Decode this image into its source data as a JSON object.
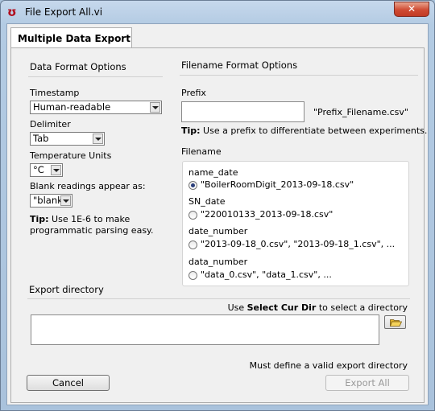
{
  "window": {
    "title": "File Export All.vi",
    "close_glyph": "✕",
    "app_icon": "labview-icon"
  },
  "tab": {
    "label": "Multiple Data Export"
  },
  "data_format": {
    "heading": "Data Format Options",
    "timestamp_label": "Timestamp",
    "timestamp_value": "Human-readable",
    "delimiter_label": "Delimiter",
    "delimiter_value": "Tab",
    "temp_units_label": "Temperature Units",
    "temp_units_value": "°C",
    "blank_label": "Blank readings appear as:",
    "blank_value": "\"blank\"",
    "tip_bold": "Tip:",
    "tip_line1": " Use 1E-6 to make",
    "tip_line2": "programmatic parsing easy."
  },
  "filename_format": {
    "heading": "Filename Format Options",
    "prefix_label": "Prefix",
    "prefix_value": "",
    "prefix_example": "\"Prefix_Filename.csv\"",
    "tip_bold": "Tip:",
    "tip_text": " Use a prefix to differentiate between experiments.",
    "filename_label": "Filename",
    "options": [
      {
        "name": "name_date",
        "example": "\"BoilerRoomDigit_2013-09-18.csv\"",
        "selected": true
      },
      {
        "name": "SN_date",
        "example": "\"220010133_2013-09-18.csv\"",
        "selected": false
      },
      {
        "name": "date_number",
        "example": "\"2013-09-18_0.csv\", \"2013-09-18_1.csv\", ...",
        "selected": false
      },
      {
        "name": "data_number",
        "example": "\"data_0.csv\", \"data_1.csv\", ...",
        "selected": false
      }
    ]
  },
  "export": {
    "heading": "Export directory",
    "hint_pre": "Use ",
    "hint_bold": "Select Cur Dir",
    "hint_post": " to select a directory",
    "path_value": "",
    "validation": "Must define a valid export directory"
  },
  "buttons": {
    "cancel": "Cancel",
    "export_all": "Export All"
  },
  "colors": {
    "title_bg": "#b3cbe3",
    "close_red": "#cf4b33",
    "radio_dot": "#2a3e7a"
  }
}
